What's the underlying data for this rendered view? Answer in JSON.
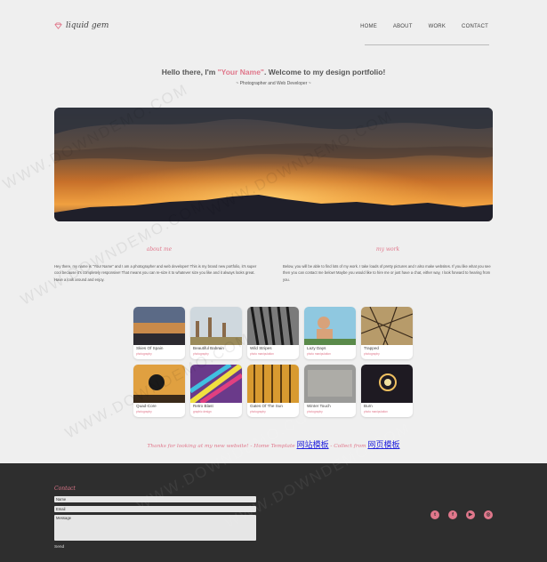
{
  "header": {
    "logo_text": "liquid gem",
    "nav": [
      "HOME",
      "ABOUT",
      "WORK",
      "CONTACT"
    ]
  },
  "hero": {
    "greeting": "Hello there, I'm ",
    "name": "\"Your Name\"",
    "welcome": ". Welcome to my design portfolio!",
    "subtitle": "~ Photographer and Web Developer ~"
  },
  "about": {
    "heading": "about me",
    "text": "Hey there, my name is \"Your Name\" and I am a photographer and web developer! This is my brand new portfolio, it's super cool because it's completely responsive! That means you can re-size it to whatever size you like and it always looks great. Have a look around and enjoy."
  },
  "work": {
    "heading": "my work",
    "text": "Below, you will be able to find lots of my work. I take loads of pretty pictures and I also make websites. If you like what you see then you can contact me below! Maybe you would like to hire me or just have a chat, either way, I look forward to hearing from you."
  },
  "portfolio": [
    {
      "title": "Skies Of Spain",
      "tag": "photography"
    },
    {
      "title": "Beautiful Bahrain",
      "tag": "photography"
    },
    {
      "title": "Wild Stripes",
      "tag": "photo manipulation"
    },
    {
      "title": "Lazy Days",
      "tag": "photo manipulation"
    },
    {
      "title": "Trapped",
      "tag": "photography"
    },
    {
      "title": "Quad-Core",
      "tag": "photography"
    },
    {
      "title": "Retro Blast",
      "tag": "graphic design"
    },
    {
      "title": "Gates Of The Sun",
      "tag": "photography"
    },
    {
      "title": "Winter Touch",
      "tag": "photography"
    },
    {
      "title": "Burn",
      "tag": "photo manipulation"
    }
  ],
  "thanks": {
    "text": "Thanks for looking at my new website! - ",
    "source": "Home Template",
    "link1": "网站模板",
    "middle": " - Collect from ",
    "link2": "网页模板"
  },
  "footer": {
    "contact_heading": "Contact",
    "name_placeholder": "Name",
    "email_placeholder": "Email",
    "message_placeholder": "Message",
    "send_label": "Send",
    "social_icons": [
      "twitter-icon",
      "facebook-icon",
      "youtube-icon",
      "dribbble-icon"
    ]
  },
  "watermark": "WWW.DOWNDEMO.COM",
  "colors": {
    "accent": "#e0778b",
    "background": "#efefef",
    "footer": "#2e2e2e"
  }
}
